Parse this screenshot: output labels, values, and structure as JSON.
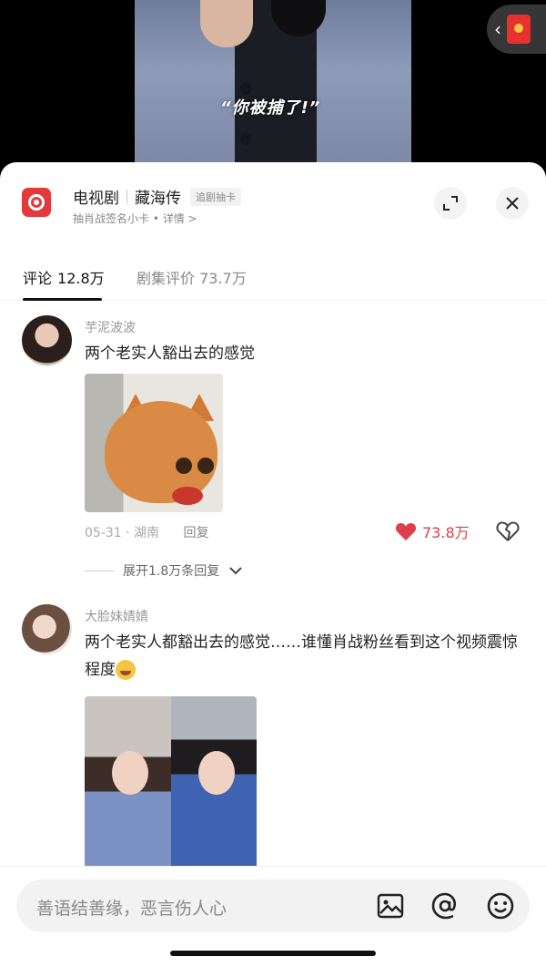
{
  "video": {
    "subtitle": "“你被捕了!”"
  },
  "show": {
    "category": "电视剧",
    "name": "藏海传",
    "tag": "追剧抽卡",
    "subtitle": "抽肖战签名小卡 • 详情 >"
  },
  "tabs": {
    "comments_label": "评论",
    "comments_count": "12.8万",
    "ratings_label": "剧集评价 73.7万"
  },
  "comments": [
    {
      "username": "芋泥波波",
      "text": "两个老实人豁出去的感觉",
      "date": "05-31",
      "location": "· 湖南",
      "reply_label": "回复",
      "likes": "73.8万",
      "expand_label": "展开1.8万条回复"
    },
    {
      "username": "大脸妹婧婧",
      "text": "两个老实人都豁出去的感觉……谁懂肖战粉丝看到这个视频震惊程度"
    }
  ],
  "input": {
    "placeholder": "善语结善缘，恶言伤人心"
  },
  "colors": {
    "like": "#e03e4b",
    "brand": "#e4393c"
  }
}
